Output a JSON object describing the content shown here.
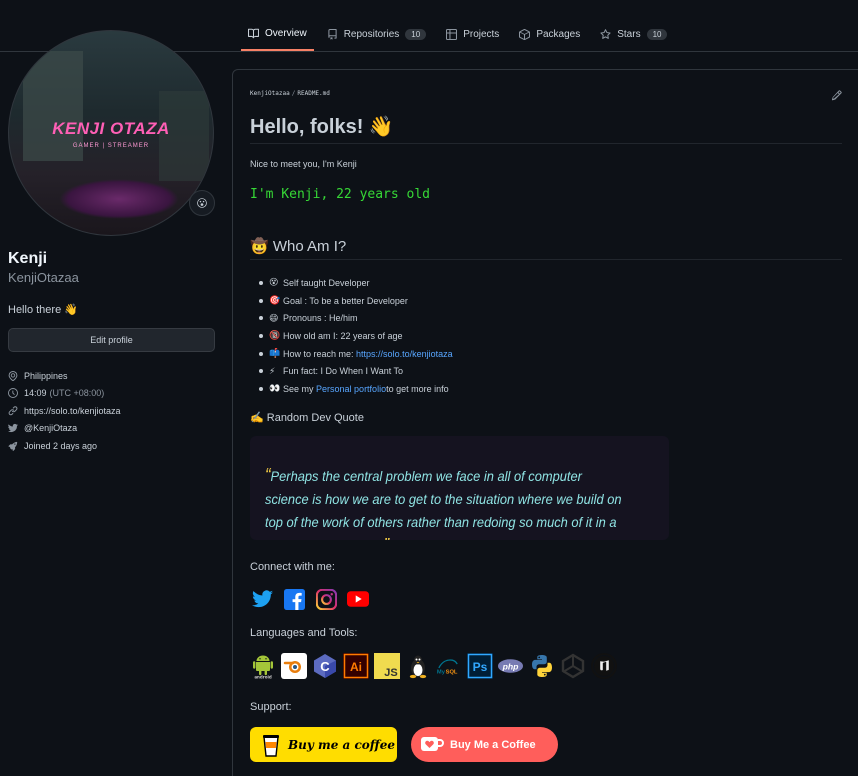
{
  "nav": {
    "tabs": [
      {
        "label": "Overview",
        "icon": "book-icon"
      },
      {
        "label": "Repositories",
        "icon": "repo-icon",
        "count": "10"
      },
      {
        "label": "Projects",
        "icon": "table-icon"
      },
      {
        "label": "Packages",
        "icon": "package-icon"
      },
      {
        "label": "Stars",
        "icon": "star-icon",
        "count": "10"
      }
    ]
  },
  "profile": {
    "avatar_title": "KENJI OTAZA",
    "avatar_subtitle": "GAMER | STREAMER",
    "status_emoji": "😮",
    "name": "Kenji",
    "login": "KenjiOtazaa",
    "bio": "Hello there 👋",
    "edit_label": "Edit profile",
    "location": "Philippines",
    "time": "14:09",
    "timezone": "(UTC +08:00)",
    "website": "https://solo.to/kenjiotaza",
    "twitter": "@KenjiOtaza",
    "joined": "Joined 2 days ago"
  },
  "readme": {
    "path_user": "KenjiOtazaa",
    "path_sep": "/",
    "path_file": "README.md",
    "heading": "Hello, folks! 👋",
    "intro": "Nice to meet you, I'm Kenji",
    "typing": "I'm Kenji, 22 years old",
    "who_heading": "🤠 Who Am I?",
    "who_items": [
      {
        "emoji": "😵",
        "text": "Self taught Developer"
      },
      {
        "emoji": "🎯",
        "text": "Goal : To be a better Developer"
      },
      {
        "emoji": "😄",
        "text": "Pronouns : He/him"
      },
      {
        "emoji": "🔞",
        "text": "How old am I: 22 years of age"
      },
      {
        "emoji": "📫",
        "text": "How to reach me: ",
        "link": "https://solo.to/kenjiotaza"
      },
      {
        "emoji": "⚡",
        "text": "Fun fact: I Do When I Want To"
      },
      {
        "emoji": "👀",
        "text": "See my ",
        "link": "Personal portfolio",
        "after": " to get more info"
      }
    ],
    "quote_heading": "✍️ Random Dev Quote",
    "quote": "Perhaps the central problem we face in all of computer science is how we are to get to the situation where we build on top of the work of others rather than redoing so much of it in a trivially different way.",
    "connect_heading": "Connect with me:",
    "socials": [
      "twitter-icon",
      "facebook-icon",
      "instagram-icon",
      "youtube-icon"
    ],
    "tools_heading": "Languages and Tools:",
    "tools": [
      "android",
      "blender",
      "C",
      "Ai",
      "JS",
      "linux",
      "MySQL",
      "Ps",
      "php",
      "python",
      "unity",
      "unreal"
    ],
    "support_heading": "Support:",
    "bmc_label": "Buy me a coffee",
    "kofi_label": "Buy Me a Coffee"
  },
  "colors": {
    "accent": "#f78166",
    "link": "#58a6ff",
    "typing": "#36d836",
    "quote": "#8fe3e3"
  }
}
